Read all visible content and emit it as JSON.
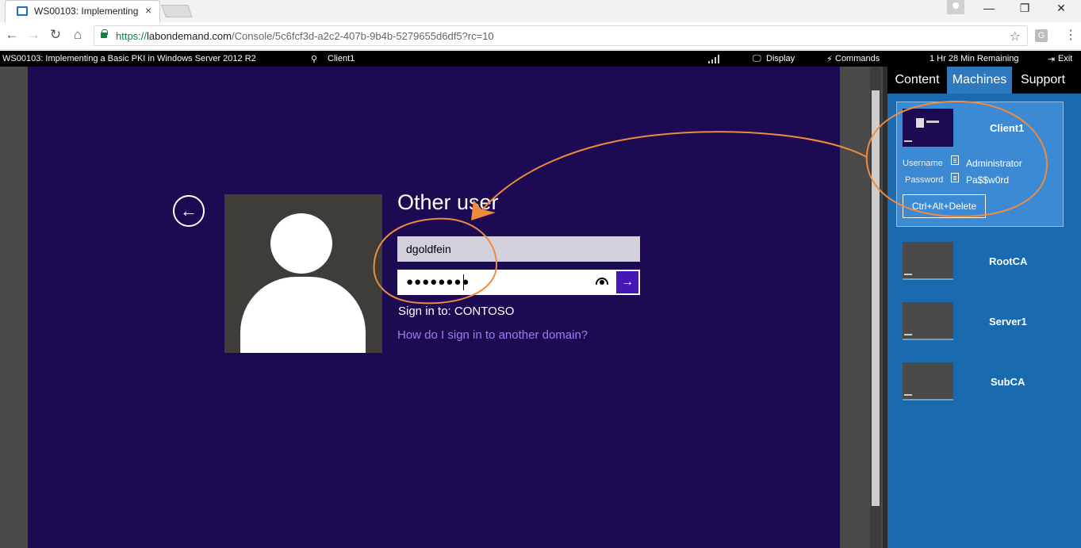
{
  "browser": {
    "tab_title": "WS00103: Implementing",
    "tab_close": "×",
    "url_scheme": "https://",
    "url_host": "labondemand.com",
    "url_path": "/Console/5c6fcf3d-a2c2-407b-9b4b-5279655d6df5?rc=10",
    "back_glyph": "←",
    "forward_glyph": "→",
    "reload_glyph": "↻",
    "home_glyph": "⌂",
    "star_glyph": "☆",
    "ext_letter": "G",
    "menu_glyph": "⋮",
    "min_glyph": "—",
    "max_glyph": "❐",
    "close_glyph": "✕"
  },
  "labbar": {
    "lab_title": "WS00103: Implementing a Basic PKI in Windows Server 2012 R2",
    "machine": "Client1",
    "display": "Display",
    "commands": "Commands",
    "remaining": "1 Hr 28 Min Remaining",
    "exit": "Exit",
    "pin_glyph": "⚲",
    "display_glyph": "🖵",
    "commands_glyph": "⚡",
    "exit_glyph": "⇥"
  },
  "login": {
    "back_glyph": "←",
    "heading": "Other user",
    "username": "dgoldfein",
    "password_mask": "●●●●●●●●",
    "submit_glyph": "→",
    "sign_in_to": "Sign in to: CONTOSO",
    "other_domain": "How do I sign in to another domain?"
  },
  "panel": {
    "tabs": [
      "Content",
      "Machines",
      "Support"
    ],
    "active_tab": "Machines",
    "machines": [
      {
        "name": "Client1",
        "username_label": "Username",
        "username": "Administrator",
        "password_label": "Password",
        "password": "Pa$$w0rd",
        "cad": "Ctrl+Alt+Delete"
      },
      {
        "name": "RootCA"
      },
      {
        "name": "Server1"
      },
      {
        "name": "SubCA"
      }
    ]
  },
  "colors": {
    "vm_background": "#1c0a52",
    "panel_blue": "#1a6ab0",
    "active_tab": "#2e78be",
    "annotation": "#f08a3c",
    "submit_button": "#4617b4",
    "link": "#a07cf0"
  }
}
